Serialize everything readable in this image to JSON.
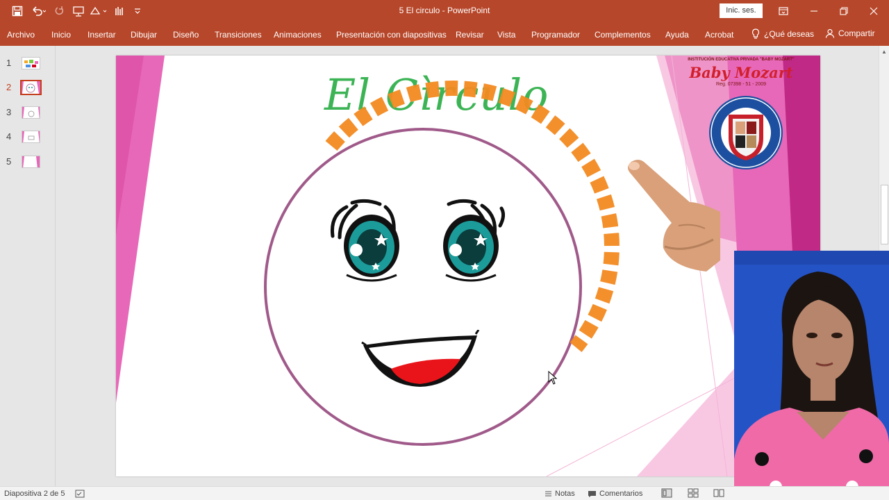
{
  "window": {
    "title": "5 El circulo  -  PowerPoint",
    "signin_label": "Inic. ses."
  },
  "ribbon": {
    "tabs": [
      "Archivo",
      "Inicio",
      "Insertar",
      "Dibujar",
      "Diseño",
      "Transiciones",
      "Animaciones",
      "Presentación con diapositivas",
      "Revisar",
      "Vista",
      "Programador",
      "Complementos",
      "Ayuda",
      "Acrobat"
    ],
    "tell_me": "¿Qué deseas",
    "share": "Compartir"
  },
  "thumbnails": [
    "1",
    "2",
    "3",
    "4",
    "5"
  ],
  "slide": {
    "title": "El Cìrculo",
    "logo": {
      "institution": "INSTITUCIÓN EDUCATIVA PRIVADA \"BABY MOZART\"",
      "name": "Baby Mozart",
      "reg": "Reg. 07398 - 51 - 2009"
    }
  },
  "statusbar": {
    "slide_info": "Diapositiva 2 de 5",
    "notes": "Notas",
    "comments": "Comentarios"
  },
  "colors": {
    "accent": "#b7472a",
    "pink": "#e768b8",
    "circle": "#a05a8a",
    "dash": "#f28a21",
    "title_green": "#3cb455"
  }
}
